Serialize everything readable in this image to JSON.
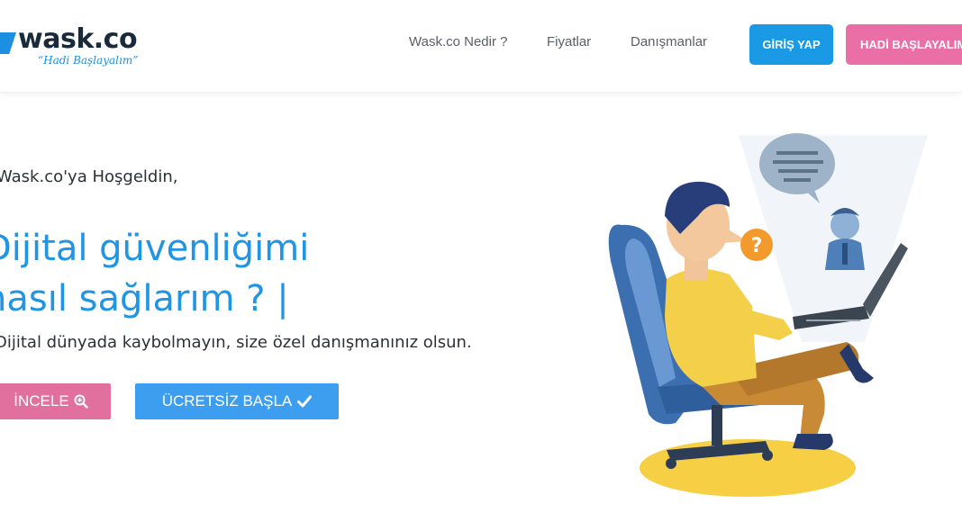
{
  "header": {
    "logo_text": "wask.co",
    "logo_tagline": "“Hadi Başlayalım”",
    "nav": [
      {
        "label": "Wask.co Nedir ?"
      },
      {
        "label": "Fiyatlar"
      },
      {
        "label": "Danışmanlar"
      }
    ],
    "login_label": "GİRİŞ YAP",
    "start_label": "HADİ BAŞLAYALIM"
  },
  "hero": {
    "welcome": "Wask.co'ya Hoşgeldin,",
    "headline_line1": "Dijital güvenliğimi",
    "headline_line2": "nasıl sağlarım ? |",
    "subtext": "Dijital dünyada kaybolmayın, size özel danışmanınız olsun.",
    "inspect_label": "İNCELE",
    "free_start_label": "ÜCRETSİZ BAŞLA"
  },
  "colors": {
    "primary_blue": "#1a9ae5",
    "pink": "#ea6fa6",
    "headline_blue": "#1f95e4"
  },
  "icons": {
    "inspect": "search-plus-icon",
    "free_start": "check-icon",
    "logo": "wask-logo-mark-icon"
  }
}
